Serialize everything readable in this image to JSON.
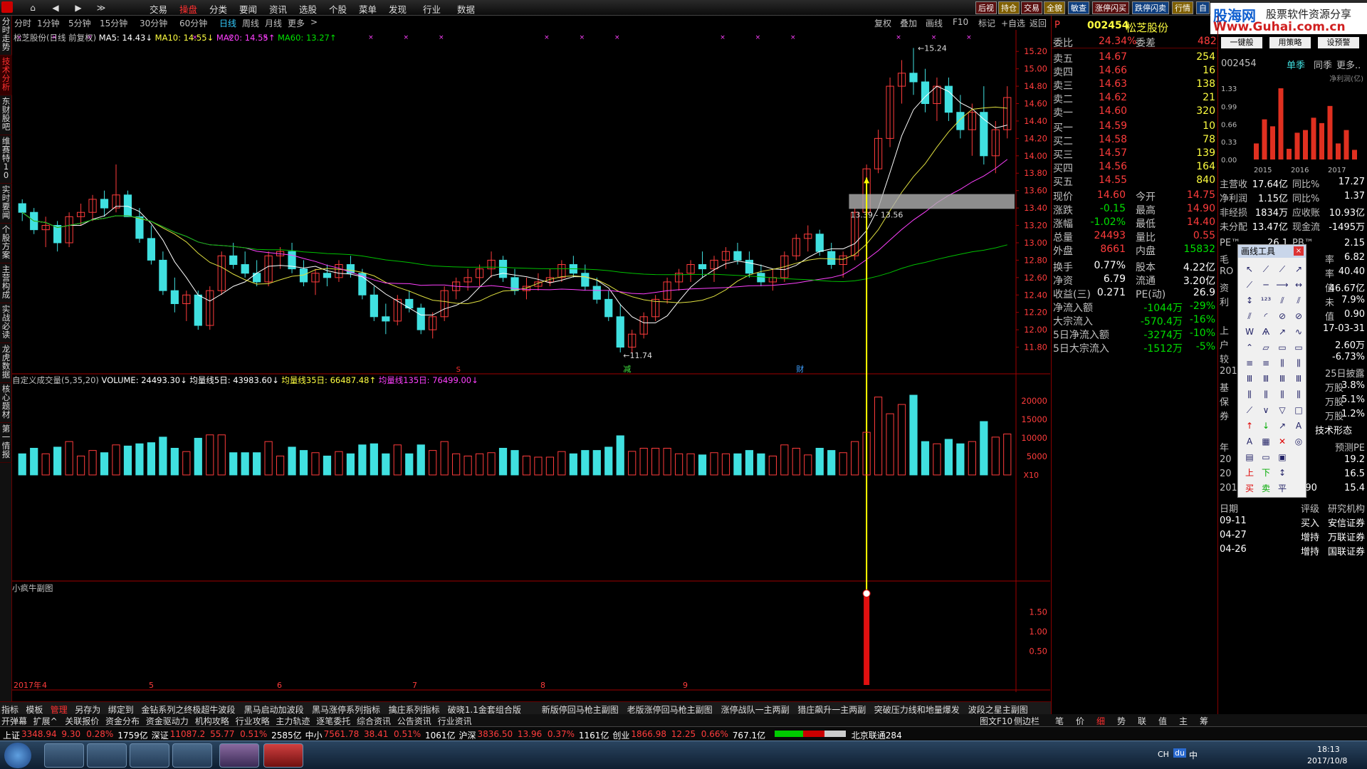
{
  "topbar": {
    "menus": [
      "交易",
      "操盘",
      "分类",
      "要闻",
      "资讯",
      "选股",
      "个股",
      "菜单",
      "发现",
      "行业",
      "数据"
    ],
    "active_menu": "操盘",
    "nav": [
      "⌂",
      "◀",
      "▶",
      "≫"
    ],
    "right_buttons": [
      "后视",
      "持仓",
      "交易",
      "全貌",
      "敏查",
      "涨停闪买",
      "跌停闪卖",
      "行情",
      "自"
    ]
  },
  "watermark": {
    "site": "股海网",
    "domain": "Www.Guhai.com.cn",
    "tag": "股票软件资源分享"
  },
  "periods": [
    "分时",
    "1分钟",
    "5分钟",
    "15分钟",
    "30分钟",
    "60分钟",
    "日线",
    "周线",
    "月线",
    "更多",
    ">"
  ],
  "active_period": "日线",
  "chart_tools": [
    "复权",
    "叠加",
    "画线",
    "F10",
    "标记",
    "+自选",
    "返回"
  ],
  "left_tabs": [
    "分时走势",
    "技术分析",
    "东财股吧",
    "维赛特10",
    "实时要闻",
    "个股方案",
    "主营构成",
    "实战必读",
    "龙虎数据",
    "核心题材",
    "第一情报"
  ],
  "chart_header": {
    "name": "松芝股份(日线 前复权)",
    "ma5": "MA5: 14.43↓",
    "ma10": "MA10: 14.55↓",
    "ma20": "MA20: 14.55↑",
    "ma60": "MA60: 13.27↑"
  },
  "volume_header": {
    "title": "自定义成交量(5,35,20)",
    "volume": "VOLUME: 24493.30↓",
    "ma5": "均量线5日: 43983.60↓",
    "ma35": "均量线35日: 66487.48↑",
    "ma135": "均量线135日: 76499.00↓"
  },
  "sub_header": "小疯牛副图",
  "price_axis": [
    "15.20",
    "15.00",
    "14.80",
    "14.60",
    "14.40",
    "14.20",
    "14.00",
    "13.80",
    "13.60",
    "13.40",
    "13.20",
    "13.00",
    "12.80",
    "12.60",
    "12.40",
    "12.20",
    "12.00",
    "11.80"
  ],
  "vol_axis": [
    "20000",
    "15000",
    "10000",
    "5000",
    "X10"
  ],
  "sub_axis": [
    "1.50",
    "1.00",
    "0.50"
  ],
  "time_axis": [
    "2017年",
    "4",
    "5",
    "6",
    "7",
    "8",
    "9"
  ],
  "annotations": {
    "high": "15.24",
    "low": "11.74",
    "range": "13.39 - 13.56",
    "event1": "减",
    "event2": "财",
    "event3": "S"
  },
  "chart_data": {
    "type": "candlestick",
    "title": "松芝股份(日线 前复权)",
    "ylim": [
      11.6,
      15.3
    ],
    "candles": [
      [
        13.45,
        13.5,
        13.25,
        13.35
      ],
      [
        13.35,
        13.4,
        13.1,
        13.15
      ],
      [
        13.15,
        13.3,
        12.95,
        13.2
      ],
      [
        13.2,
        13.25,
        12.9,
        13.0
      ],
      [
        13.0,
        13.35,
        12.95,
        13.3
      ],
      [
        13.3,
        13.45,
        13.2,
        13.35
      ],
      [
        13.35,
        13.55,
        13.25,
        13.5
      ],
      [
        13.5,
        13.6,
        13.3,
        13.4
      ],
      [
        13.4,
        13.9,
        13.35,
        13.55
      ],
      [
        13.55,
        13.6,
        13.3,
        13.3
      ],
      [
        13.3,
        13.4,
        13.0,
        13.05
      ],
      [
        13.05,
        13.2,
        12.75,
        12.8
      ],
      [
        12.8,
        12.9,
        12.4,
        12.45
      ],
      [
        12.45,
        12.6,
        12.2,
        12.3
      ],
      [
        12.3,
        12.45,
        12.1,
        12.4
      ],
      [
        12.4,
        12.45,
        12.0,
        12.05
      ],
      [
        12.05,
        12.5,
        12.0,
        12.45
      ],
      [
        12.45,
        12.9,
        12.4,
        12.85
      ],
      [
        12.85,
        13.0,
        12.7,
        12.75
      ],
      [
        12.75,
        12.9,
        12.6,
        12.65
      ],
      [
        12.65,
        12.8,
        12.5,
        12.55
      ],
      [
        12.55,
        12.9,
        12.5,
        12.85
      ],
      [
        12.85,
        12.95,
        12.7,
        12.9
      ],
      [
        12.9,
        13.0,
        12.65,
        12.7
      ],
      [
        12.7,
        12.8,
        12.5,
        12.55
      ],
      [
        12.55,
        12.7,
        12.4,
        12.65
      ],
      [
        12.65,
        12.75,
        12.5,
        12.6
      ],
      [
        12.6,
        12.8,
        12.55,
        12.75
      ],
      [
        12.75,
        12.85,
        12.6,
        12.65
      ],
      [
        12.65,
        12.7,
        12.35,
        12.4
      ],
      [
        12.4,
        12.5,
        12.1,
        12.15
      ],
      [
        12.15,
        12.3,
        11.95,
        12.1
      ],
      [
        12.1,
        12.4,
        12.05,
        12.35
      ],
      [
        12.35,
        12.45,
        12.2,
        12.25
      ],
      [
        12.25,
        12.3,
        11.95,
        12.0
      ],
      [
        12.0,
        12.2,
        11.9,
        12.15
      ],
      [
        12.15,
        12.5,
        12.1,
        12.45
      ],
      [
        12.45,
        12.6,
        12.35,
        12.55
      ],
      [
        12.55,
        12.7,
        12.45,
        12.6
      ],
      [
        12.6,
        12.75,
        12.5,
        12.7
      ],
      [
        12.7,
        12.9,
        12.6,
        12.8
      ],
      [
        12.8,
        12.85,
        12.55,
        12.6
      ],
      [
        12.6,
        12.7,
        12.4,
        12.45
      ],
      [
        12.45,
        12.6,
        12.35,
        12.5
      ],
      [
        12.5,
        12.65,
        12.45,
        12.55
      ],
      [
        12.55,
        12.7,
        12.5,
        12.6
      ],
      [
        12.6,
        12.8,
        12.55,
        12.75
      ],
      [
        12.75,
        12.85,
        12.6,
        12.65
      ],
      [
        12.65,
        12.75,
        12.45,
        12.5
      ],
      [
        12.5,
        12.6,
        12.3,
        12.35
      ],
      [
        12.35,
        12.45,
        12.1,
        12.15
      ],
      [
        12.15,
        12.3,
        11.74,
        11.8
      ],
      [
        11.8,
        12.0,
        11.74,
        11.95
      ],
      [
        11.95,
        12.2,
        11.9,
        12.15
      ],
      [
        12.15,
        12.4,
        12.1,
        12.35
      ],
      [
        12.35,
        12.6,
        12.3,
        12.55
      ],
      [
        12.55,
        12.7,
        12.45,
        12.65
      ],
      [
        12.65,
        12.8,
        12.55,
        12.75
      ],
      [
        12.75,
        12.9,
        12.6,
        12.7
      ],
      [
        12.7,
        12.85,
        12.55,
        12.8
      ],
      [
        12.8,
        12.95,
        12.7,
        12.9
      ],
      [
        12.9,
        13.0,
        12.75,
        12.8
      ],
      [
        12.8,
        12.9,
        12.6,
        12.65
      ],
      [
        12.65,
        12.75,
        12.5,
        12.55
      ],
      [
        12.55,
        12.7,
        12.45,
        12.6
      ],
      [
        12.6,
        12.9,
        12.55,
        12.85
      ],
      [
        12.85,
        13.1,
        12.8,
        13.05
      ],
      [
        13.05,
        13.2,
        12.9,
        13.1
      ],
      [
        13.1,
        13.15,
        12.85,
        12.9
      ],
      [
        12.9,
        13.0,
        12.7,
        12.75
      ],
      [
        12.75,
        12.9,
        12.6,
        12.85
      ],
      [
        12.85,
        13.4,
        12.8,
        13.35
      ],
      [
        13.35,
        13.9,
        13.3,
        13.85
      ],
      [
        13.85,
        14.3,
        13.8,
        14.2
      ],
      [
        14.2,
        14.9,
        14.1,
        14.8
      ],
      [
        14.8,
        15.1,
        14.6,
        14.95
      ],
      [
        14.95,
        15.24,
        14.7,
        14.85
      ],
      [
        14.85,
        15.0,
        14.5,
        14.6
      ],
      [
        14.6,
        14.9,
        14.4,
        14.8
      ],
      [
        14.8,
        14.9,
        14.4,
        14.5
      ],
      [
        14.5,
        14.7,
        14.2,
        14.3
      ],
      [
        14.3,
        14.6,
        14.0,
        14.5
      ],
      [
        14.5,
        14.8,
        13.9,
        14.0
      ],
      [
        14.0,
        14.4,
        13.8,
        14.3
      ],
      [
        14.3,
        14.8,
        14.2,
        14.67
      ]
    ]
  },
  "quote": {
    "code": "002454",
    "name": "松芝股份",
    "weibi_label": "委比",
    "weibi": "24.34%",
    "weicha_label": "委差",
    "weicha": "482",
    "asks": [
      [
        "卖五",
        "14.67",
        "254"
      ],
      [
        "卖四",
        "14.66",
        "16"
      ],
      [
        "卖三",
        "14.63",
        "138"
      ],
      [
        "卖二",
        "14.62",
        "21"
      ],
      [
        "卖一",
        "14.60",
        "320"
      ]
    ],
    "bids": [
      [
        "买一",
        "14.59",
        "10"
      ],
      [
        "买二",
        "14.58",
        "78"
      ],
      [
        "买三",
        "14.57",
        "139"
      ],
      [
        "买四",
        "14.56",
        "164"
      ],
      [
        "买五",
        "14.55",
        "840"
      ]
    ],
    "stats": [
      [
        "现价",
        "14.60",
        "今开",
        "14.75"
      ],
      [
        "涨跌",
        "-0.15",
        "最高",
        "14.90"
      ],
      [
        "涨幅",
        "-1.02%",
        "最低",
        "14.40"
      ],
      [
        "总量",
        "24493",
        "量比",
        "0.55"
      ],
      [
        "外盘",
        "8661",
        "内盘",
        "15832"
      ],
      [
        "换手",
        "0.77%",
        "股本",
        "4.22亿"
      ],
      [
        "净资",
        "6.79",
        "流通",
        "3.20亿"
      ],
      [
        "收益(三)",
        "0.271",
        "PE(动)",
        "26.9"
      ]
    ],
    "flows": [
      [
        "净流入额",
        "-1044万",
        "-29%"
      ],
      [
        "大宗流入",
        "-570.4万",
        "-16%"
      ],
      [
        "5日净流入额",
        "-3274万",
        "-10%"
      ],
      [
        "5日大宗流入",
        "-1512万",
        "-5%"
      ]
    ]
  },
  "finance": {
    "buttons": [
      "一键般",
      "用策略",
      "设预警"
    ],
    "code": "002454",
    "tabs": [
      "单季",
      "同季",
      "更多.."
    ],
    "bar_label": "净利润(亿)",
    "bar_axis": [
      "1.33",
      "0.99",
      "0.66",
      "0.33",
      "0.00"
    ],
    "years": [
      "2015",
      "2016",
      "2017"
    ],
    "bars": [
      0.3,
      0.75,
      0.62,
      1.33,
      0.2,
      0.5,
      0.55,
      0.78,
      0.68,
      1.0,
      0.3,
      0.55,
      0.18
    ],
    "rows": [
      [
        "主营收",
        "17.64亿",
        "同比%",
        "17.27"
      ],
      [
        "净利润",
        "1.15亿",
        "同比%",
        "1.37"
      ],
      [
        "非经损",
        "1834万",
        "应收账",
        "10.93亿"
      ],
      [
        "未分配",
        "13.47亿",
        "现金流",
        "-1495万"
      ],
      [
        "PE™",
        "26.1",
        "PB™",
        "2.15"
      ]
    ],
    "rows2": [
      [
        "毛",
        "",
        "率",
        "6.82"
      ],
      [
        "RO",
        "",
        "率",
        "40.40"
      ],
      [
        "资",
        "",
        "值",
        "46.67亿"
      ],
      [
        "利",
        "",
        "未",
        "7.9%"
      ],
      [
        "",
        "",
        "值",
        "0.90"
      ],
      [
        "上",
        "",
        "",
        "17-03-31"
      ],
      [
        "户",
        "",
        "",
        "2.60万"
      ],
      [
        "较",
        "",
        "",
        "-6.73%"
      ],
      [
        "201",
        "",
        "25日披露",
        ""
      ],
      [
        "基",
        "",
        "万股",
        "3.8%"
      ],
      [
        "保",
        "",
        "万股",
        "5.1%"
      ],
      [
        "券",
        "",
        "万股",
        "1.2%"
      ]
    ],
    "morph": "技术形态",
    "pe_head": [
      "年",
      "",
      "预测PE"
    ],
    "pe_rows": [
      [
        "20",
        "",
        "19.2"
      ],
      [
        "20",
        "",
        "16.5"
      ],
      [
        "2019",
        "0.90",
        "15.4"
      ]
    ],
    "rating_head": [
      "日期",
      "评级",
      "研究机构"
    ],
    "ratings": [
      [
        "09-11",
        "买入",
        "安信证券"
      ],
      [
        "04-27",
        "增持",
        "万联证券"
      ],
      [
        "04-26",
        "增持",
        "国联证券"
      ]
    ]
  },
  "drawtool": {
    "title": "画线工具",
    "close": "×"
  },
  "bottom_tabs": [
    "指标",
    "模板",
    "管理",
    "另存为",
    "绑定到",
    "金钻系列之终极超牛波段",
    "黑马启动加波段",
    "黑马涨停系列指标",
    "擒庄系列指标",
    "破晓1.1金套组合版",
    "新版停回马枪主副图",
    "老版涨停回马枪主副图",
    "涨停战队一主两副",
    "猎庄飙升一主两副",
    "突破压力线和地量爆发",
    "波段之星主副图"
  ],
  "bottom_tabs2": [
    "开弹幕",
    "扩展^",
    "关联报价",
    "资金分布",
    "资金驱动力",
    "机构攻略",
    "行业攻略",
    "主力轨迹",
    "逐笔委托",
    "综合资讯",
    "公告资讯",
    "行业资讯"
  ],
  "bottom_right": [
    "图文F10",
    "侧边栏"
  ],
  "right_bottom_tabs": [
    "笔",
    "价",
    "细",
    "势",
    "联",
    "值",
    "主",
    "筹"
  ],
  "status": [
    {
      "label": "上证",
      "val": "3348.94",
      "chg": "9.30",
      "pct": "0.28%",
      "amt": "1759亿"
    },
    {
      "label": "深证",
      "val": "11087.2",
      "chg": "55.77",
      "pct": "0.51%",
      "amt": "2585亿"
    },
    {
      "label": "中小",
      "val": "7561.78",
      "chg": "38.41",
      "pct": "0.51%",
      "amt": "1061亿"
    },
    {
      "label": "沪深",
      "val": "3836.50",
      "chg": "13.96",
      "pct": "0.37%",
      "amt": "1161亿"
    },
    {
      "label": "创业",
      "val": "1866.98",
      "chg": "12.25",
      "pct": "0.66%",
      "amt": "767.1亿"
    }
  ],
  "status_right": "北京联通284",
  "clock": {
    "time": "18:13",
    "date": "2017/10/8"
  },
  "tray": [
    "CH",
    "du",
    "中"
  ]
}
